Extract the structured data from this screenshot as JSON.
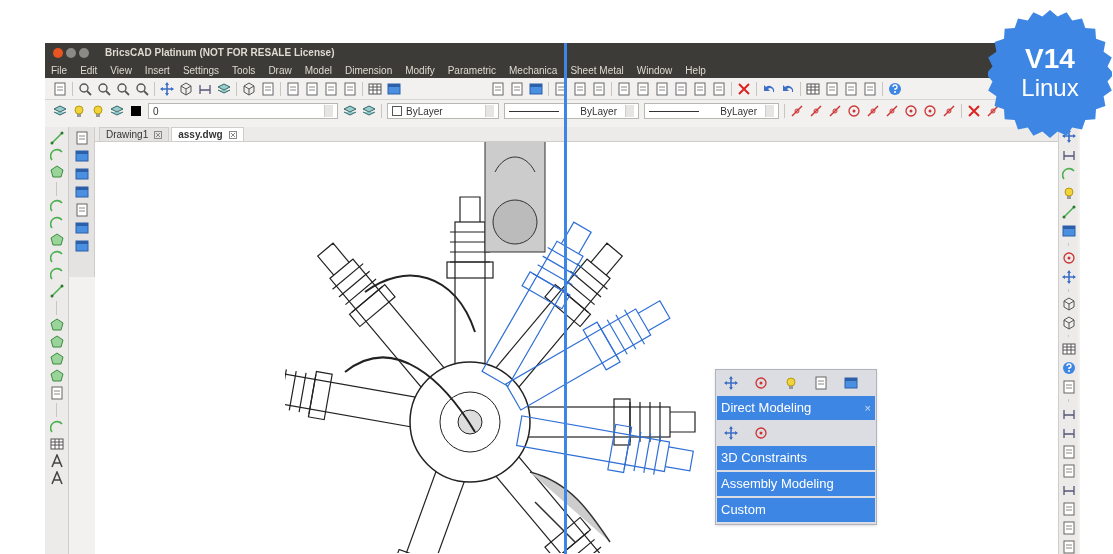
{
  "window": {
    "title": "BricsCAD Platinum (NOT FOR RESALE License)"
  },
  "menu": [
    "File",
    "Edit",
    "View",
    "Insert",
    "Settings",
    "Tools",
    "Draw",
    "Model",
    "Dimension",
    "Modify",
    "Parametric",
    "Mechanica",
    "Sheet Metal",
    "Window",
    "Help"
  ],
  "layer_toolbar": {
    "layer": "0",
    "color_field": "ByLayer",
    "linetype": "ByLayer",
    "lineweight": "ByLayer"
  },
  "tabs": [
    {
      "label": "Drawing1",
      "selected": false
    },
    {
      "label": "assy.dwg",
      "selected": true
    }
  ],
  "quad_menu": {
    "title": "Direct Modeling",
    "close": "×",
    "items": [
      {
        "label": "3D Constraints"
      },
      {
        "label": "Assembly Modeling"
      },
      {
        "label": "Custom"
      }
    ]
  },
  "badge": {
    "version": "V14",
    "platform": "Linux"
  }
}
